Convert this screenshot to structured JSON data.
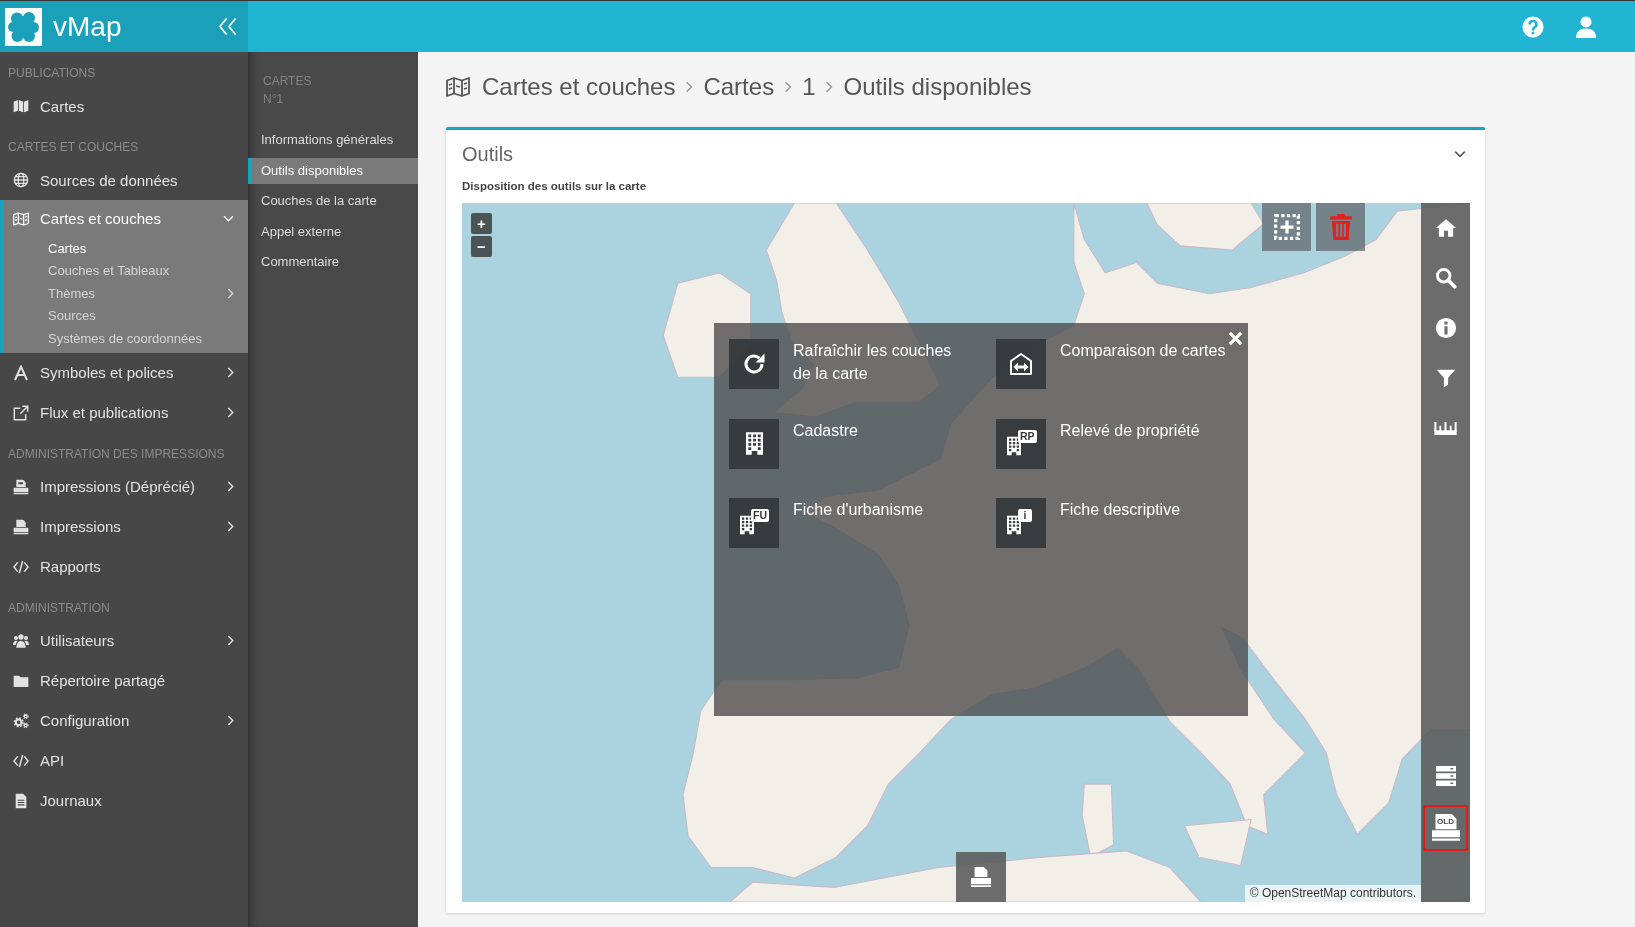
{
  "topbar": {
    "app_name": "vMap"
  },
  "sidebar": {
    "sections": [
      {
        "title": "PUBLICATIONS",
        "items": [
          {
            "label": "Cartes",
            "kind": "link",
            "selected": false
          }
        ]
      },
      {
        "title": "CARTES ET COUCHES",
        "items": [
          {
            "label": "Sources de données",
            "kind": "link",
            "selected": false
          },
          {
            "label": "Cartes et couches",
            "kind": "group",
            "selected": true,
            "expanded": true,
            "children": [
              {
                "label": "Cartes",
                "kind": "link",
                "selected": true
              },
              {
                "label": "Couches et Tableaux",
                "kind": "link",
                "selected": false
              },
              {
                "label": "Thèmes",
                "kind": "group",
                "selected": false,
                "expanded": false
              },
              {
                "label": "Sources",
                "kind": "link",
                "selected": false
              },
              {
                "label": "Systèmes de coordonnées",
                "kind": "link",
                "selected": false
              }
            ]
          },
          {
            "label": "Symboles et polices",
            "kind": "group",
            "selected": false,
            "expanded": false
          },
          {
            "label": "Flux et publications",
            "kind": "group",
            "selected": false,
            "expanded": false
          }
        ]
      },
      {
        "title": "ADMINISTRATION DES IMPRESSIONS",
        "items": [
          {
            "label": "Impressions (Déprécié)",
            "kind": "group",
            "selected": false,
            "expanded": false
          },
          {
            "label": "Impressions",
            "kind": "group",
            "selected": false,
            "expanded": false
          },
          {
            "label": "Rapports",
            "kind": "link",
            "selected": false
          }
        ]
      },
      {
        "title": "ADMINISTRATION",
        "items": [
          {
            "label": "Utilisateurs",
            "kind": "group",
            "selected": false,
            "expanded": false
          },
          {
            "label": "Répertoire partagé",
            "kind": "link",
            "selected": false
          },
          {
            "label": "Configuration",
            "kind": "group",
            "selected": false,
            "expanded": false
          },
          {
            "label": "API",
            "kind": "link",
            "selected": false
          },
          {
            "label": "Journaux",
            "kind": "link",
            "selected": false
          }
        ]
      }
    ]
  },
  "subnav": {
    "title": "CARTES",
    "subtitle": "N°1",
    "items": [
      {
        "label": "Informations générales",
        "selected": false
      },
      {
        "label": "Outils disponibles",
        "selected": true
      },
      {
        "label": "Couches de la carte",
        "selected": false
      },
      {
        "label": "Appel externe",
        "selected": false
      },
      {
        "label": "Commentaire",
        "selected": false
      }
    ]
  },
  "breadcrumb": [
    "Cartes et couches",
    "Cartes",
    "1",
    "Outils disponibles"
  ],
  "panel": {
    "title": "Outils",
    "expanded": true,
    "subtitle": "Disposition des outils sur la carte",
    "map": {
      "zoom_in": "+",
      "zoom_out": "−",
      "side_toolbar": {
        "top": [
          {
            "selected": false
          },
          {
            "selected": false
          },
          {
            "selected": false
          },
          {
            "selected": false
          },
          {
            "selected": false
          }
        ],
        "bottom": [
          {
            "selected": false
          },
          {
            "selected": true,
            "icon_badge": "OLD"
          }
        ]
      },
      "tools_menu": [
        {
          "label": "Rafraîchir les couches de la carte"
        },
        {
          "label": "Comparaison de cartes"
        },
        {
          "label": "Cadastre"
        },
        {
          "label": "Relevé de propriété",
          "icon_badge": "RP"
        },
        {
          "label": "Fiche d'urbanisme",
          "icon_badge": "FU"
        },
        {
          "label": "Fiche descriptive",
          "icon_badge": "i"
        }
      ],
      "attribution": "© OpenStreetMap contributors."
    }
  }
}
